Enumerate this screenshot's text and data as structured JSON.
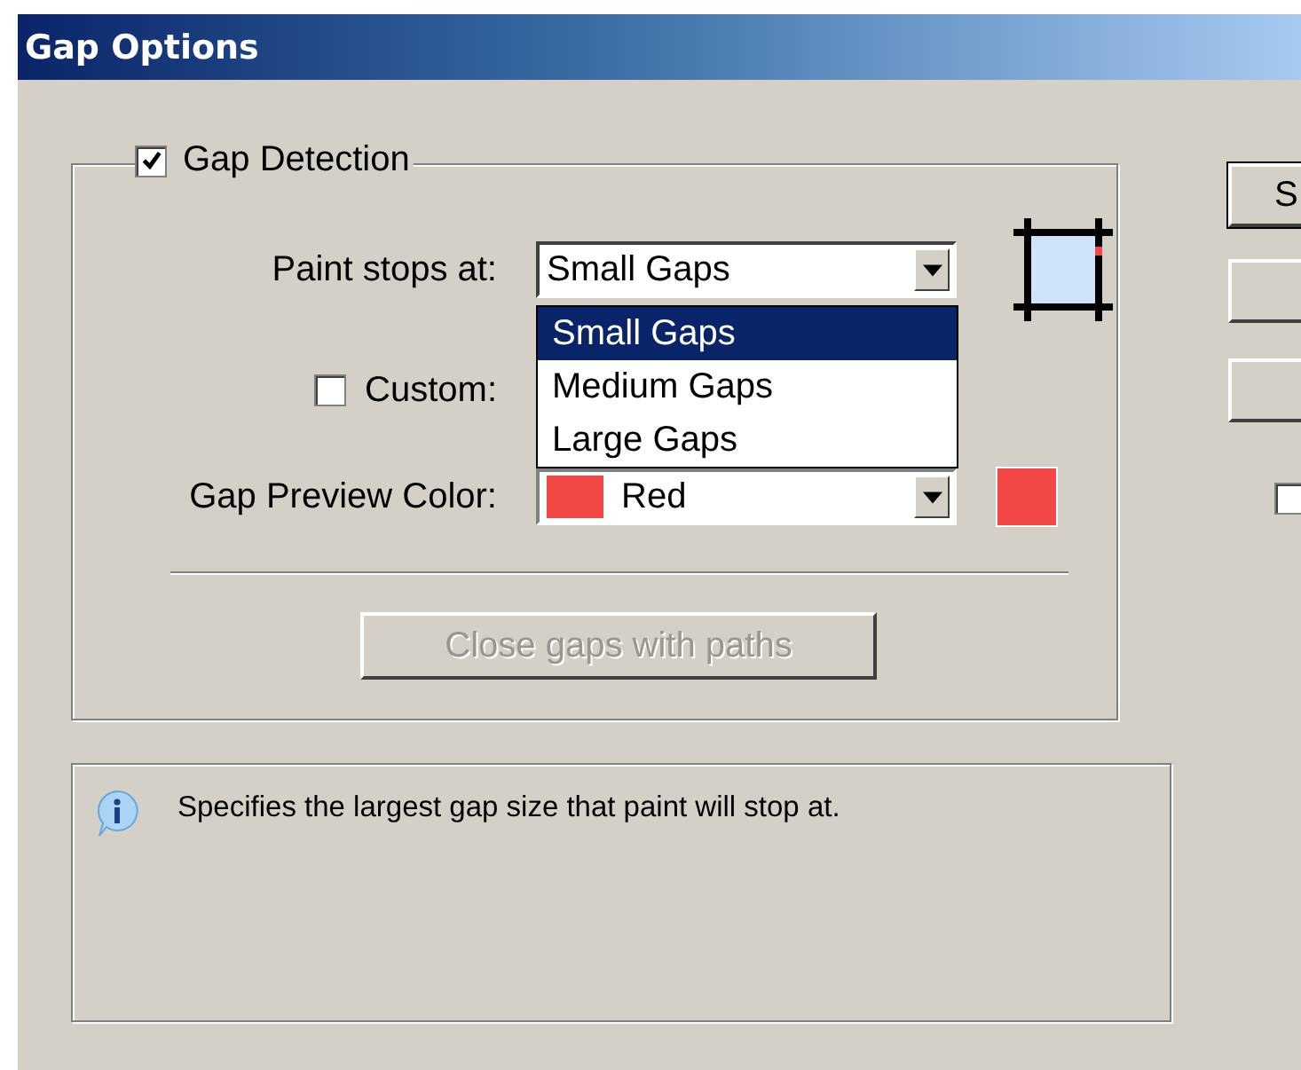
{
  "window": {
    "title": "Gap Options"
  },
  "gap_detection": {
    "label": "Gap Detection",
    "checked": true
  },
  "paint_stops_at": {
    "label": "Paint stops at:",
    "value": "Small Gaps",
    "expanded": true,
    "options": [
      {
        "label": "Small Gaps",
        "selected": true
      },
      {
        "label": "Medium Gaps",
        "selected": false
      },
      {
        "label": "Large Gaps",
        "selected": false
      }
    ]
  },
  "custom": {
    "label": "Custom:",
    "checked": false
  },
  "gap_preview_color": {
    "label": "Gap Preview Color:",
    "value": "Red",
    "color": "#f44848"
  },
  "close_gaps_button": {
    "label": "Close gaps with paths",
    "disabled": true
  },
  "info": {
    "text": "Specifies the largest gap size that paint will stop at."
  },
  "side_buttons": [
    {
      "kind": "text",
      "label": "S",
      "default": true
    },
    {
      "kind": "blank",
      "default": false
    },
    {
      "kind": "blank",
      "default": false
    }
  ],
  "side_checkbox": {
    "checked": false
  }
}
